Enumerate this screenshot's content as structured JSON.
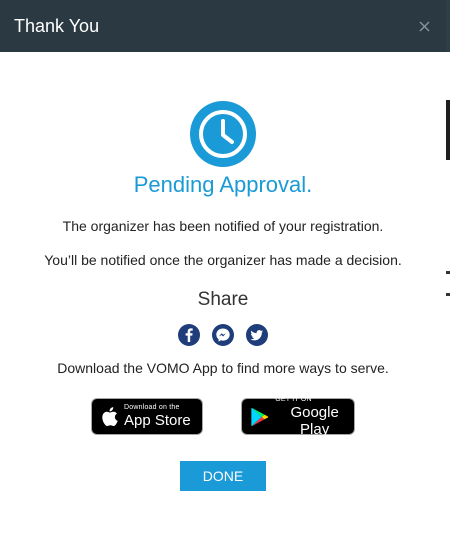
{
  "modal": {
    "title": "Thank You",
    "close_icon": "close-icon"
  },
  "status": {
    "icon": "clock-icon",
    "headline": "Pending Approval.",
    "color": "#1a9ad6"
  },
  "messages": {
    "notified": "The organizer has been notified of your registration.",
    "decision": "You’ll be notified once the organizer has made a decision."
  },
  "share": {
    "title": "Share",
    "icons": [
      "facebook-icon",
      "messenger-icon",
      "twitter-icon"
    ]
  },
  "download": {
    "text": "Download the VOMO App to find more ways to serve.",
    "app_store_small": "Download on the",
    "app_store_big": "App Store",
    "google_play_small": "GET IT ON",
    "google_play_big": "Google Play"
  },
  "actions": {
    "done_label": "DONE"
  },
  "colors": {
    "header_bg": "#2b3a42",
    "accent": "#1a9ad6",
    "social": "#1e3d7a"
  }
}
